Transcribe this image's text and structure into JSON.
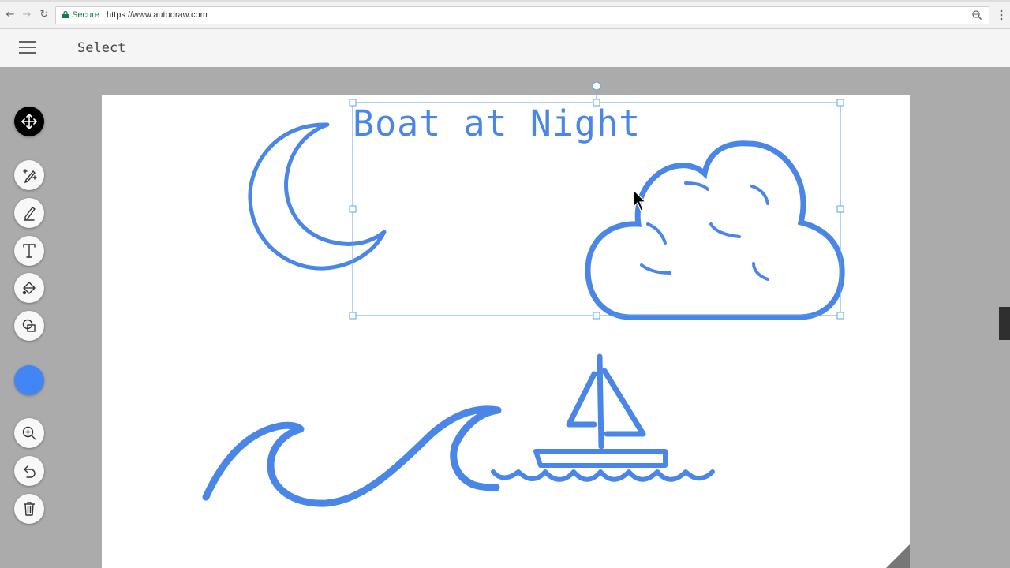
{
  "browser": {
    "secure_label": "Secure",
    "url": "https://www.autodraw.com"
  },
  "toolbar": {
    "mode_title": "Select"
  },
  "tools": [
    {
      "name": "move-tool",
      "icon": "four-arrows-icon",
      "active": true
    },
    {
      "name": "autodraw-tool",
      "icon": "magic-pen-icon"
    },
    {
      "name": "draw-tool",
      "icon": "pencil-icon"
    },
    {
      "name": "type-tool",
      "icon": "text-t-icon"
    },
    {
      "name": "fill-tool",
      "icon": "paint-bucket-icon"
    },
    {
      "name": "shape-tool",
      "icon": "shapes-icon"
    },
    {
      "name": "color-picker",
      "icon": "color-swatch"
    },
    {
      "name": "zoom-tool",
      "icon": "zoom-in-icon"
    },
    {
      "name": "undo-tool",
      "icon": "undo-icon"
    },
    {
      "name": "delete-tool",
      "icon": "trash-icon"
    }
  ],
  "canvas": {
    "title_text": "Boat at Night",
    "drawings": [
      "crescent-moon",
      "cloud",
      "wave",
      "sailboat"
    ]
  },
  "colors": {
    "stroke": "#4a86e8",
    "selected_color": "#4285f4",
    "selection_box": "#5aa8e6"
  }
}
